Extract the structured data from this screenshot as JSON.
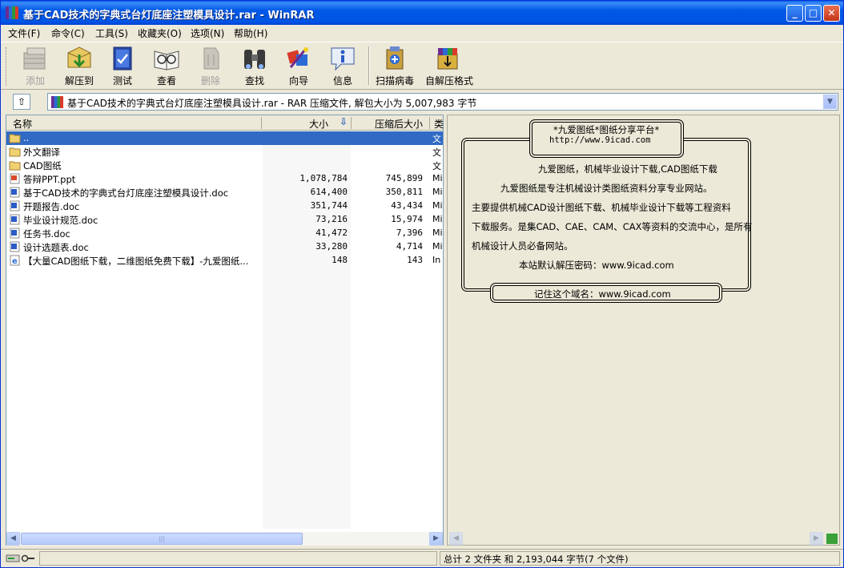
{
  "window": {
    "title": "基于CAD技术的字典式台灯底座注塑模具设计.rar - WinRAR",
    "minimize": "_",
    "maximize": "□",
    "close": "✕"
  },
  "menu": [
    "文件(F)",
    "命令(C)",
    "工具(S)",
    "收藏夹(O)",
    "选项(N)",
    "帮助(H)"
  ],
  "toolbar": {
    "add": "添加",
    "extract": "解压到",
    "test": "测试",
    "view": "查看",
    "delete": "删除",
    "find": "查找",
    "wizard": "向导",
    "info": "信息",
    "virus": "扫描病毒",
    "sfx": "自解压格式"
  },
  "address": {
    "up": "⇧",
    "text": "基于CAD技术的字典式台灯底座注塑模具设计.rar - RAR 压缩文件, 解包大小为 5,007,983 字节",
    "dropdown": "▼"
  },
  "columns": {
    "name": "名称",
    "size": "大小",
    "packed": "压缩后大小",
    "type": "类",
    "sort_arrow": "⇩"
  },
  "files": [
    {
      "name": "..",
      "size": "",
      "packed": "",
      "type": "文",
      "icon": "folder-up"
    },
    {
      "name": "外文翻译",
      "size": "",
      "packed": "",
      "type": "文",
      "icon": "folder"
    },
    {
      "name": "CAD图纸",
      "size": "",
      "packed": "",
      "type": "文",
      "icon": "folder"
    },
    {
      "name": "答辩PPT.ppt",
      "size": "1,078,784",
      "packed": "745,899",
      "type": "Mi",
      "icon": "ppt"
    },
    {
      "name": "基于CAD技术的字典式台灯底座注塑模具设计.doc",
      "size": "614,400",
      "packed": "350,811",
      "type": "Mi",
      "icon": "doc"
    },
    {
      "name": "开题报告.doc",
      "size": "351,744",
      "packed": "43,434",
      "type": "Mi",
      "icon": "doc"
    },
    {
      "name": "毕业设计规范.doc",
      "size": "73,216",
      "packed": "15,974",
      "type": "Mi",
      "icon": "doc"
    },
    {
      "name": "任务书.doc",
      "size": "41,472",
      "packed": "7,396",
      "type": "Mi",
      "icon": "doc"
    },
    {
      "name": "设计选题表.doc",
      "size": "33,280",
      "packed": "4,714",
      "type": "Mi",
      "icon": "doc"
    },
    {
      "name": "【大量CAD图纸下载，二维图纸免费下载】-九爱图纸...",
      "size": "148",
      "packed": "143",
      "type": "In",
      "icon": "ie"
    }
  ],
  "comment": {
    "header1": "*九爱图纸*图纸分享平台*",
    "header2": "http://www.9icad.com",
    "line1": "九爱图纸，机械毕业设计下载,CAD图纸下载",
    "line2": "九爱图纸是专注机械设计类图纸资料分享专业网站。",
    "line3": "主要提供机械CAD设计图纸下载、机械毕业设计下载等工程资料",
    "line4": "下载服务。是集CAD、CAE、CAM、CAX等资料的交流中心，是所有",
    "line5": "机械设计人员必备网站。",
    "line6": "本站默认解压密码：www.9icad.com",
    "footer": "记住这个域名：www.9icad.com"
  },
  "status": {
    "right": "总计 2 文件夹 和 2,193,044 字节(7 个文件)"
  }
}
